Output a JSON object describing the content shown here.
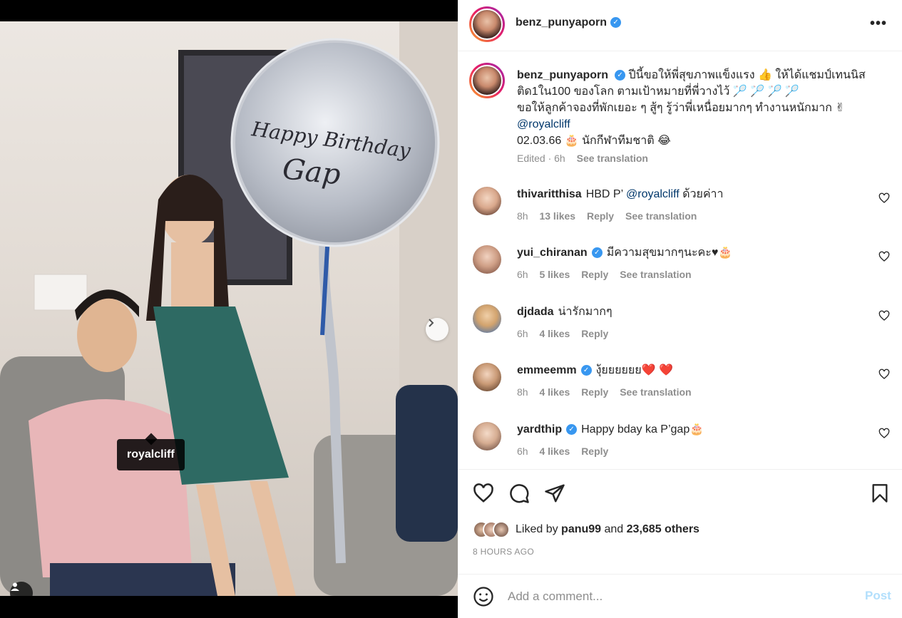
{
  "media": {
    "tag_label": "royalcliff",
    "balloon_line1": "Happy Birthday",
    "balloon_line2": "Gap",
    "dots_count": 6,
    "active_dot": 0
  },
  "header": {
    "username": "benz_punyaporn",
    "verified_mark": "✓",
    "more_icon": "more-horizontal-icon"
  },
  "caption": {
    "username": "benz_punyaporn",
    "line1": "ปีนี้ขอให้พี่สุขภาพแข็งแรง 👍  ให้ได้แชมป์เทนนิสติด1ใน100 ของโลก ตามเป้าหมายที่พี่วางไว้ 🏸 🏸 🏸 🏸",
    "line2": "ขอให้ลูกค้าจองที่พักเยอะ ๆ สู้ๆ รู้ว่าพี่เหนื่อยมากๆ ทำงานหนักมาก ✌",
    "mention": "@royalcliff",
    "line3": "02.03.66 🎂  นักกีฬาทีมชาติ 😂",
    "edited": "Edited · 6h",
    "see_translation": "See translation"
  },
  "comments": [
    {
      "username": "thivaritthisa",
      "verified": false,
      "text_before": "HBD P’ ",
      "mention": "@royalcliff",
      "text_after": " ด้วยค่าา",
      "time": "8h",
      "likes": "13 likes",
      "reply": "Reply",
      "translate": "See translation"
    },
    {
      "username": "yui_chiranan",
      "verified": true,
      "text_before": "มีความสุขมากๆนะคะ♥🎂",
      "mention": "",
      "text_after": "",
      "time": "6h",
      "likes": "5 likes",
      "reply": "Reply",
      "translate": "See translation"
    },
    {
      "username": "djdada",
      "verified": false,
      "text_before": "น่ารักมากๆ",
      "mention": "",
      "text_after": "",
      "time": "6h",
      "likes": "4 likes",
      "reply": "Reply",
      "translate": ""
    },
    {
      "username": "emmeemm",
      "verified": true,
      "text_before": "งุ้ยยยยยย❤️ ❤️",
      "mention": "",
      "text_after": "",
      "time": "8h",
      "likes": "4 likes",
      "reply": "Reply",
      "translate": "See translation"
    },
    {
      "username": "yardthip",
      "verified": true,
      "text_before": "Happy bday ka P’gap🎂",
      "mention": "",
      "text_after": "",
      "time": "6h",
      "likes": "4 likes",
      "reply": "Reply",
      "translate": ""
    }
  ],
  "actions": {
    "liked_prefix": "Liked by ",
    "liked_user": "panu99",
    "liked_middle": " and ",
    "liked_count": "23,685 others",
    "time_ago": "8 HOURS AGO"
  },
  "comment_box": {
    "placeholder": "Add a comment...",
    "post_label": "Post"
  },
  "colors": {
    "verified": "#3897f0",
    "mention": "#00376b",
    "muted": "#8e8e8e",
    "post_disabled": "#b2dffc"
  }
}
